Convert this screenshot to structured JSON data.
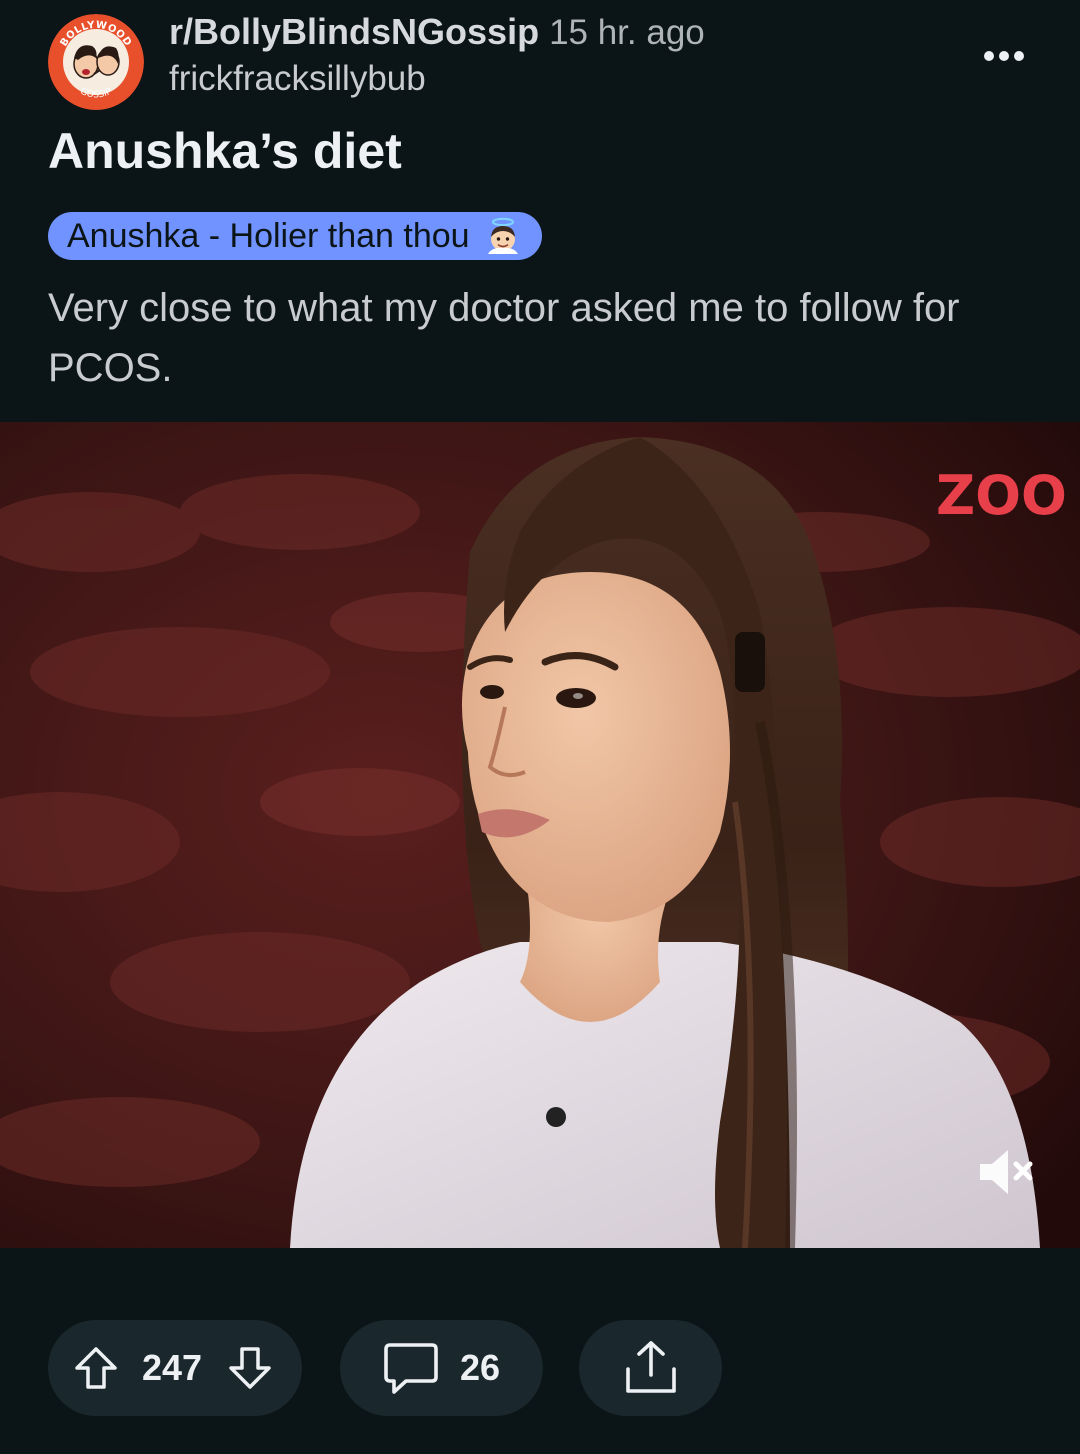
{
  "post": {
    "subreddit": "r/BollyBlindsNGossip",
    "time_ago": "15 hr. ago",
    "username": "frickfracksillybub",
    "title": "Anushka’s diet",
    "flair": "Anushka - Holier than thou",
    "body": "Very close to what my doctor asked me to follow for PCOS."
  },
  "avatar": {
    "logo_text_top": "BOLLYWOOD",
    "logo_text_bottom": "GOSSIP"
  },
  "video": {
    "watermark": "ZOO",
    "muted": true
  },
  "actions": {
    "upvotes": "247",
    "comments": "26"
  },
  "icons": {
    "more": "more-horizontal-icon",
    "upvote": "arrow-up-icon",
    "downvote": "arrow-down-icon",
    "comment": "speech-bubble-icon",
    "share": "share-upload-icon",
    "mute": "speaker-muted-icon",
    "flair_emoji": "angel-face-icon"
  },
  "colors": {
    "background": "#0b1416",
    "flair": "#7193ff",
    "pill": "#1a282d",
    "avatar_brand": "#e8502c"
  }
}
